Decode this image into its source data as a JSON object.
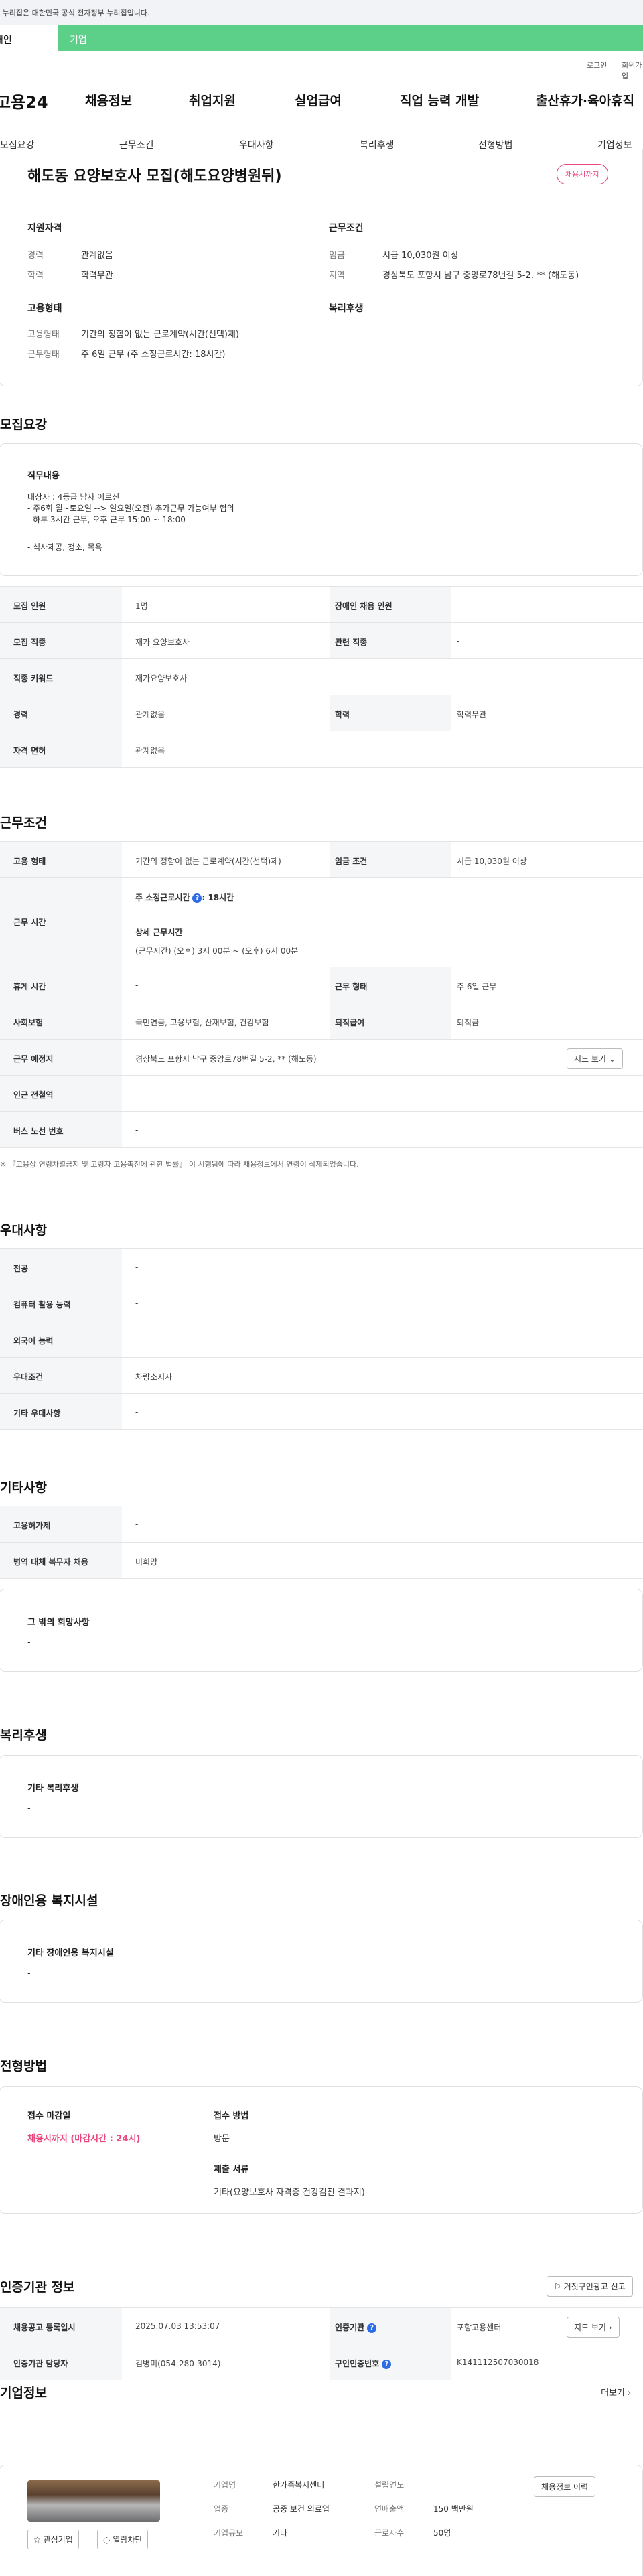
{
  "gov_banner": {
    "text": "이 누리집은 대한민국 공식 전자정부 누리집입니다."
  },
  "service_tabs": {
    "personal": "개인",
    "corporate": "기업"
  },
  "util": {
    "login": "로그인",
    "signup": "회원가입"
  },
  "gnb": {
    "logo": "고용24",
    "items": [
      "채용정보",
      "취업지원",
      "실업급여",
      "직업 능력 개발",
      "출산휴가·육아휴직"
    ]
  },
  "subnav": [
    "모집요강",
    "근무조건",
    "우대사항",
    "복리후생",
    "전형방법",
    "기업정보"
  ],
  "header": {
    "title": "해도동 요양보호사 모집(해도요양병원뒤)",
    "badge": "채용시까지",
    "qualification": {
      "title": "지원자격",
      "career_label": "경력",
      "career": "관계없음",
      "edu_label": "학력",
      "edu": "학력무관"
    },
    "conditions": {
      "title": "근무조건",
      "wage_label": "임금",
      "wage": "시급 10,030원 이상",
      "region_label": "지역",
      "region": "경상북도 포항시 남구 중앙로78번길 5-2, ** (해도동)"
    },
    "employment": {
      "title": "고용형태",
      "type_label": "고용형태",
      "type": "기간의 정함이 없는 근로계약(시간(선택)제)",
      "hours_label": "근무형태",
      "hours": "주 6일 근무 (주 소정근로시간: 18시간)"
    },
    "welfare": {
      "title": "복리후생"
    }
  },
  "recruit": {
    "title": "모집요강",
    "duty_title": "직무내용",
    "duty_lines": [
      "대상자 : 4등급 남자 어르신",
      "- 주6회  월~토요일 --> 일요일(오전) 추가근무 가능여부 협의",
      "- 하루 3시간  근무,  오후 근무 15:00 ~ 18:00",
      "- 식사제공, 청소, 목욕"
    ],
    "table": [
      [
        "모집 인원",
        "1명",
        "장애인 채용 인원",
        "-"
      ],
      [
        "모집 직종",
        "재가 요양보호사",
        "관련 직종",
        "-"
      ],
      [
        "직종 키워드",
        "재가요양보호사",
        "",
        ""
      ],
      [
        "경력",
        "관계없음",
        "학력",
        "학력무관"
      ],
      [
        "자격 면허",
        "관계없음",
        "",
        ""
      ]
    ]
  },
  "work": {
    "title": "근무조건",
    "emp_type_h": "고용 형태",
    "emp_type": "기간의 정함이 없는 근로계약(시간(선택)제)",
    "wage_h": "임금 조건",
    "wage": "시급 10,030원 이상",
    "time_h": "근무 시간",
    "weekly": "주 소정근로시간",
    "weekly_val": ": 18시간",
    "detail_title": "상세 근무시간",
    "detail": "(근무시간) (오후) 3시 00분 ~ (오후) 6시 00분",
    "rest_h": "휴게 시간",
    "rest": "-",
    "form_h": "근무 형태",
    "form": "주 6일 근무",
    "insurance_h": "사회보험",
    "insurance": "국민연금, 고용보험, 산재보험, 건강보험",
    "severance_h": "퇴직급여",
    "severance": "퇴직금",
    "place_h": "근무 예정지",
    "place": "경상북도 포항시 남구 중앙로78번길 5-2, ** (해도동)",
    "map_btn": "지도 보기",
    "subway_h": "인근 전철역",
    "subway": "-",
    "bus_h": "버스 노선 번호",
    "bus": "-",
    "note": "※ 『고용상 연령차별금지 및 고령자 고용촉진에 관한 법률』 이 시행됨에 따라 채용정보에서 연령이 삭제되었습니다."
  },
  "pref": {
    "title": "우대사항",
    "rows": [
      [
        "전공",
        "-"
      ],
      [
        "컴퓨터 활용 능력",
        "-"
      ],
      [
        "외국어 능력",
        "-"
      ],
      [
        "우대조건",
        "차량소지자"
      ],
      [
        "기타 우대사항",
        "-"
      ]
    ]
  },
  "etc": {
    "title": "기타사항",
    "rows": [
      [
        "고용허가제",
        "-"
      ],
      [
        "병역 대체 복무자 채용",
        "비희망"
      ]
    ],
    "other_title": "그 밖의 희망사항",
    "other": "-"
  },
  "benefit": {
    "title": "복리후생",
    "sub": "기타 복리후생",
    "val": "-"
  },
  "disabled": {
    "title": "장애인용 복지시설",
    "sub": "기타 장애인용 복지시설",
    "val": "-"
  },
  "selection": {
    "title": "전형방법",
    "deadline_h": "접수 마감일",
    "deadline": "채용시까지 (마감시간 : 24시)",
    "method_h": "접수 방법",
    "method": "방문",
    "docs_h": "제출 서류",
    "docs": "기타(요양보호사 자격증 건강검진 결과지)"
  },
  "cert": {
    "title": "인증기관 정보",
    "report_btn": "거짓구인광고 신고",
    "reg_h": "채용공고 등록일시",
    "reg": "2025.07.03 13:53:07",
    "org_h": "인증기관",
    "org": "포항고용센터",
    "map_btn": "지도 보기",
    "mgr_h": "인증기관 담당자",
    "mgr": "김병미(054-280-3014)",
    "no_h": "구인인증번호",
    "no": "K141112507030018"
  },
  "company": {
    "title": "기업정보",
    "more": "더보기",
    "name_h": "기업명",
    "name": "한가족복지센터",
    "year_h": "설립연도",
    "year": "-",
    "ind_h": "업종",
    "ind": "공중 보건 의료업",
    "sales_h": "연매출액",
    "sales": "150 백만원",
    "size_h": "기업규모",
    "size": "기타",
    "emp_h": "근로자수",
    "emp": "50명",
    "jobs_btn": "채용정보 이력",
    "fav_btn": "관심기업",
    "block_btn": "열람차단"
  }
}
